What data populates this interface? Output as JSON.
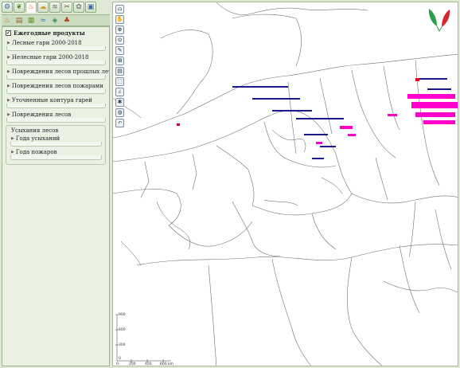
{
  "toolbar": {
    "tabs": [
      {
        "icon": "globe-gear-icon"
      },
      {
        "icon": "leaf-icon"
      },
      {
        "icon": "fire-icon"
      },
      {
        "icon": "cloud-icon"
      },
      {
        "icon": "layers-icon"
      },
      {
        "icon": "tools-icon"
      },
      {
        "icon": "gear-icon"
      },
      {
        "icon": "window-icon"
      }
    ],
    "subtabs": [
      {
        "icon": "fire-icon"
      },
      {
        "icon": "document-icon"
      },
      {
        "icon": "map-layer-icon"
      },
      {
        "icon": "wave-icon"
      },
      {
        "icon": "stack-icon"
      },
      {
        "icon": "burned-trees-icon"
      }
    ]
  },
  "panel": {
    "title": "Ежегодные продукты",
    "items": [
      "Лесные гари 2000-2018",
      "Нелесные гари 2000-2018",
      "Повреждения лесов прошлых лет",
      "Повреждения лесов пожарами",
      "Уточненные контура гарей",
      "Повреждения лесов"
    ],
    "fieldset": {
      "legend": "Усыхания лесов",
      "items": [
        "Года усыханий",
        "Года пожаров"
      ]
    }
  },
  "map": {
    "tools": [
      "home-icon",
      "pan-icon",
      "zoom-extent-icon",
      "zoom-in-icon",
      "measure-icon",
      "zoom-box-icon",
      "print-icon",
      "select-icon",
      "line-icon",
      "marker-icon",
      "globe-icon",
      "undo-icon"
    ],
    "scale": {
      "vertical_ticks": [
        "900",
        "600",
        "300",
        "0"
      ],
      "horizontal_ticks": [
        "0",
        "200",
        "400",
        "600 km"
      ]
    },
    "colors": {
      "border": "#707070",
      "coast": "#505050",
      "fire_dense": "#ff00cc",
      "fire_dark": "#1a1a8c",
      "fire_red": "#e0002a"
    }
  }
}
